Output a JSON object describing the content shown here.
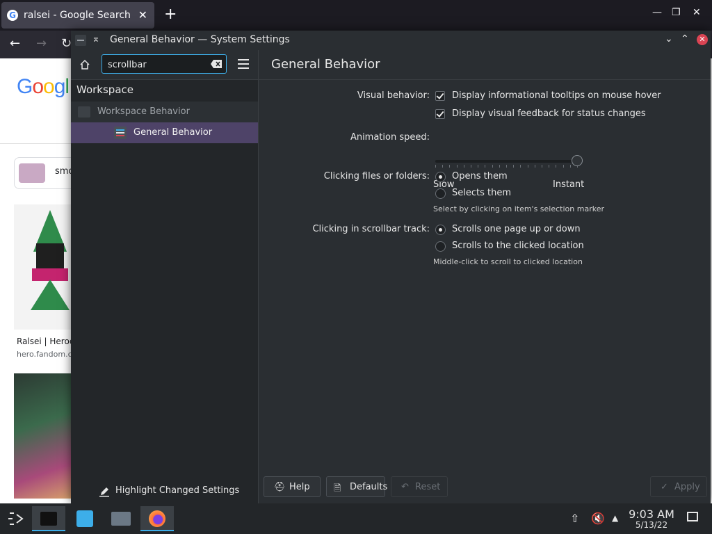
{
  "browser": {
    "tab_title": "ralsei - Google Search",
    "logo": "Googl",
    "chip_text": "smo",
    "result1_caption": "Ralsei | Heroes",
    "result1_source": "hero.fandom.co"
  },
  "window": {
    "title": "General Behavior — System Settings"
  },
  "sidebar": {
    "search_value": "scrollbar",
    "section_title": "Workspace",
    "items": [
      {
        "label": "Workspace Behavior"
      },
      {
        "label": "General Behavior"
      }
    ],
    "highlight_label": "Highlight Changed Settings"
  },
  "main": {
    "title": "General Behavior",
    "visual_behavior": {
      "label": "Visual behavior:",
      "options": [
        {
          "label": "Display informational tooltips on mouse hover",
          "checked": true
        },
        {
          "label": "Display visual feedback for status changes",
          "checked": true
        }
      ]
    },
    "animation": {
      "label": "Animation speed:",
      "min_label": "Slow",
      "max_label": "Instant",
      "value_fraction": 1.0
    },
    "clicking_files": {
      "label": "Clicking files or folders:",
      "options": [
        {
          "label": "Opens them",
          "selected": true
        },
        {
          "label": "Selects them",
          "selected": false
        }
      ],
      "hint": "Select by clicking on item's selection marker"
    },
    "scrollbar_track": {
      "label": "Clicking in scrollbar track:",
      "options": [
        {
          "label": "Scrolls one page up or down",
          "selected": true
        },
        {
          "label": "Scrolls to the clicked location",
          "selected": false
        }
      ],
      "hint": "Middle-click to scroll to clicked location"
    },
    "buttons": {
      "help": "Help",
      "defaults": "Defaults",
      "reset": "Reset",
      "apply": "Apply"
    }
  },
  "taskbar": {
    "time": "9:03 AM",
    "date": "5/13/22"
  },
  "colors": {
    "accent": "#3daee9",
    "selection": "#4e4368",
    "close": "#da4453"
  }
}
